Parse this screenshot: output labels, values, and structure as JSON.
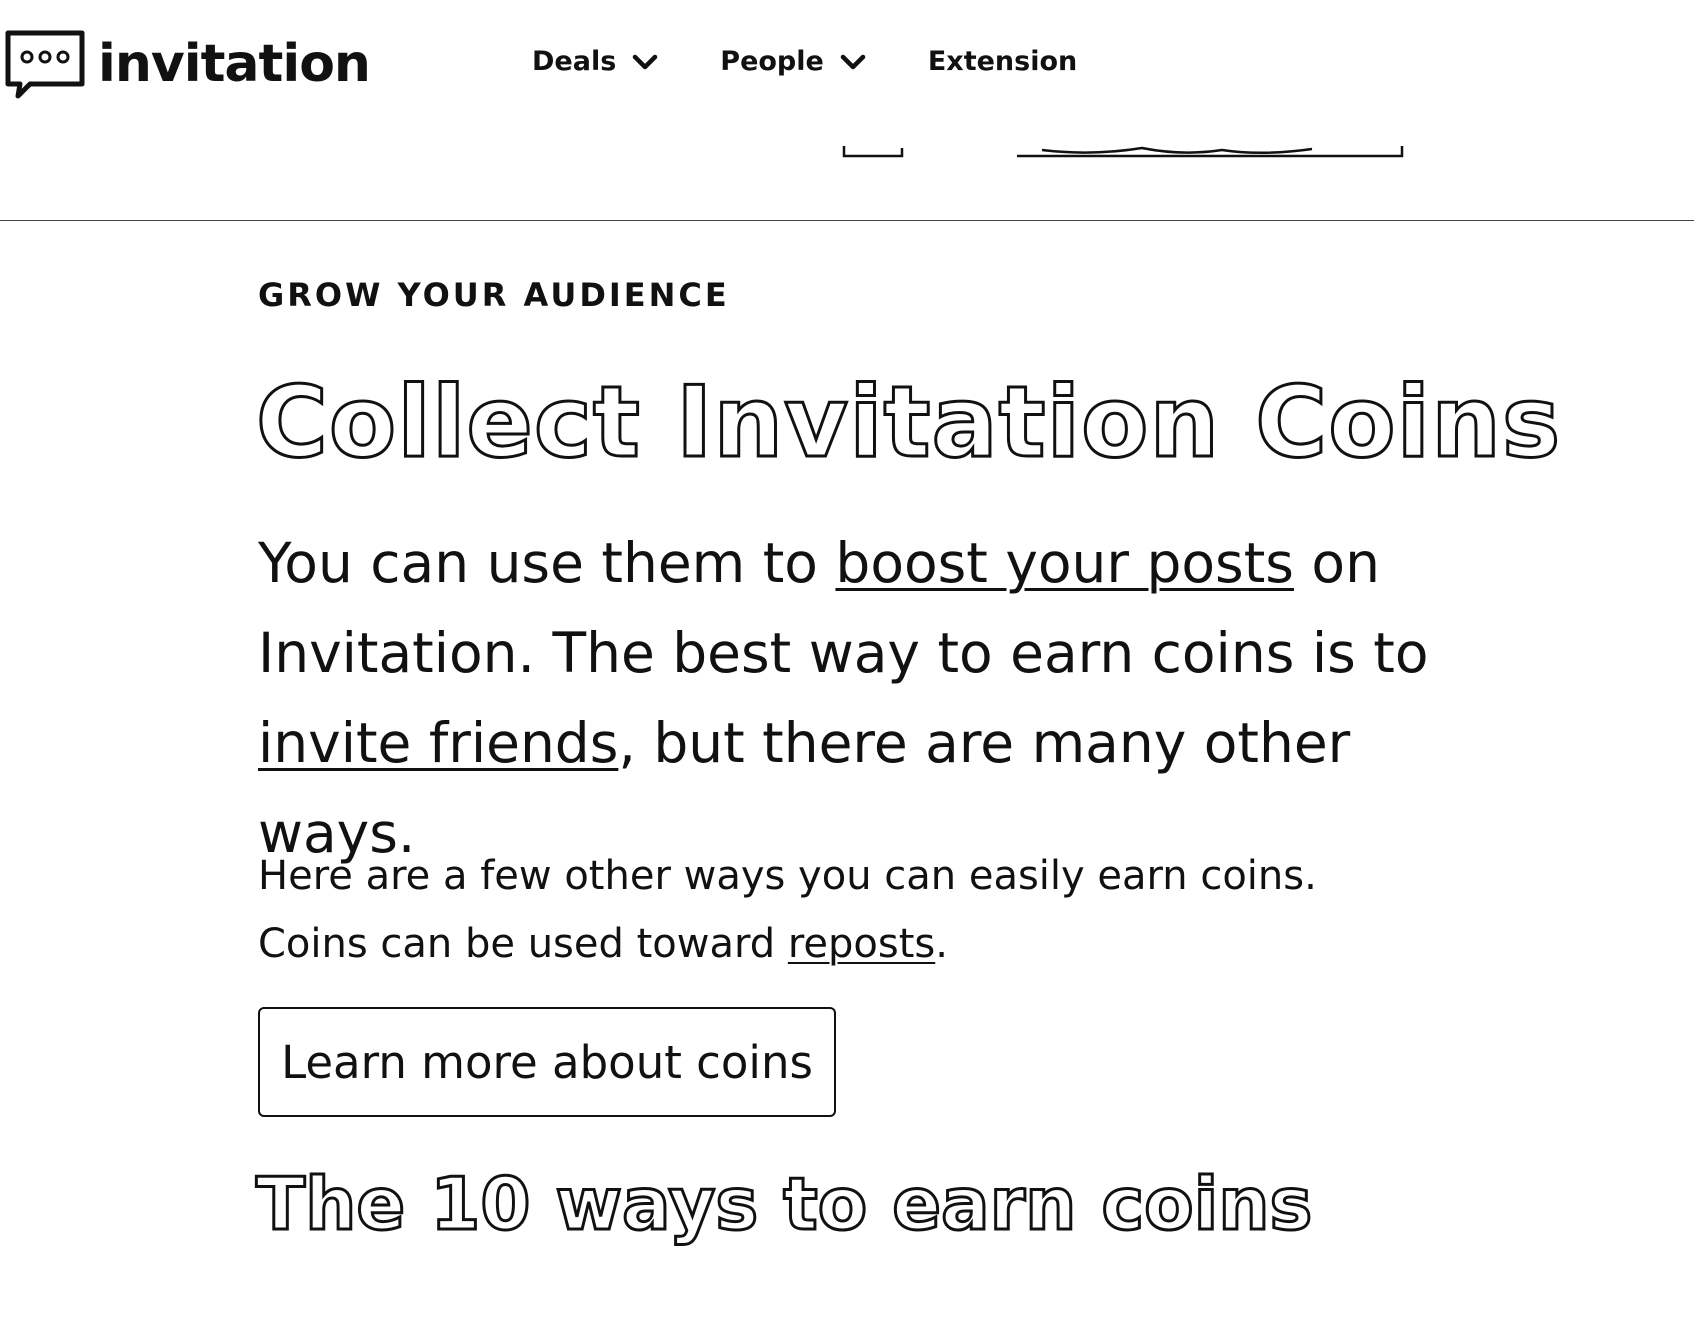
{
  "header": {
    "logo_icon": "speech-bubble-dots-icon",
    "logo_text": "invitation",
    "nav": [
      {
        "label": "Deals",
        "icon": "chevron-down-icon"
      },
      {
        "label": "People",
        "icon": "chevron-down-icon"
      },
      {
        "label": "Extension"
      }
    ]
  },
  "main": {
    "eyebrow": "GROW YOUR AUDIENCE",
    "title": "Collect Invitation Coins",
    "lead": {
      "part1": "You can use them to ",
      "link1": "boost your posts",
      "part2": " on Invitation. The best way to earn coins is to ",
      "link2": "invite friends",
      "part3": ", but there are many other ways."
    },
    "small": {
      "line1": "Here are a few other ways you can easily earn coins.",
      "line2_prefix": "Coins can be used toward ",
      "line2_link": "reposts",
      "line2_suffix": "."
    },
    "cta_label": "Learn more about coins",
    "section_title": "The 10 ways to earn coins"
  },
  "colors": {
    "text": "#111111",
    "background": "#ffffff"
  }
}
